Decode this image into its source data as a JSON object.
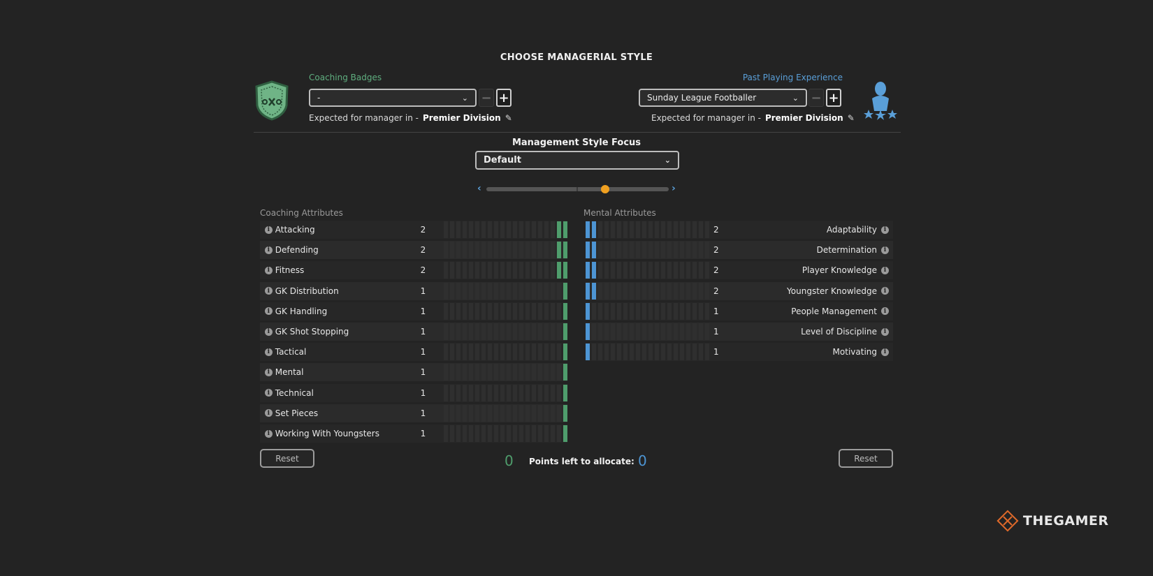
{
  "title": "CHOOSE MANAGERIAL STYLE",
  "coaching_badges": {
    "label": "Coaching Badges",
    "value": "-",
    "expected_prefix": "Expected for manager in  -",
    "expected_value": "Premier Division"
  },
  "playing_experience": {
    "label": "Past Playing Experience",
    "value": "Sunday League Footballer",
    "expected_prefix": "Expected for manager in  -",
    "expected_value": "Premier Division"
  },
  "focus": {
    "title": "Management Style Focus",
    "value": "Default",
    "slider_position": 0.66
  },
  "coaching_attributes": {
    "title": "Coaching Attributes",
    "max": 20,
    "rows": [
      {
        "label": "Attacking",
        "value": "2"
      },
      {
        "label": "Defending",
        "value": "2"
      },
      {
        "label": "Fitness",
        "value": "2"
      },
      {
        "label": "GK Distribution",
        "value": "1"
      },
      {
        "label": "GK Handling",
        "value": "1"
      },
      {
        "label": "GK Shot Stopping",
        "value": "1"
      },
      {
        "label": "Tactical",
        "value": "1"
      },
      {
        "label": "Mental",
        "value": "1"
      },
      {
        "label": "Technical",
        "value": "1"
      },
      {
        "label": "Set Pieces",
        "value": "1"
      },
      {
        "label": "Working With Youngsters",
        "value": "1"
      }
    ]
  },
  "mental_attributes": {
    "title": "Mental Attributes",
    "max": 20,
    "rows": [
      {
        "label": "Adaptability",
        "value": "2"
      },
      {
        "label": "Determination",
        "value": "2"
      },
      {
        "label": "Player Knowledge",
        "value": "2"
      },
      {
        "label": "Youngster Knowledge",
        "value": "2"
      },
      {
        "label": "People Management",
        "value": "1"
      },
      {
        "label": "Level of Discipline",
        "value": "1"
      },
      {
        "label": "Motivating",
        "value": "1"
      }
    ]
  },
  "footer": {
    "reset_label": "Reset",
    "points_label": "Points left to allocate:",
    "coaching_points": "0",
    "mental_points": "0"
  },
  "watermark": "THEGAMER",
  "colors": {
    "green": "#4f9d6c",
    "blue": "#4d95d4",
    "accent_orange": "#f0a020"
  },
  "icons": {
    "badge": "shield-tactics-icon",
    "experience": "player-stars-icon",
    "info": "info-icon",
    "edit": "pencil-icon"
  }
}
